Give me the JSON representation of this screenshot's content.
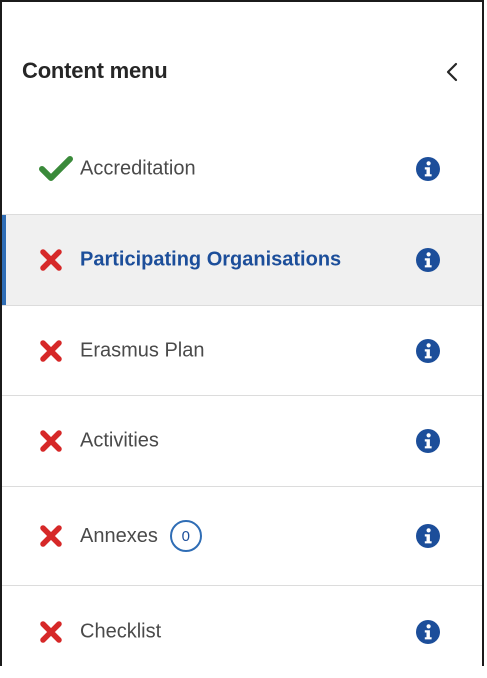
{
  "header": {
    "title": "Content menu",
    "collapse_icon": "chevron-left-icon"
  },
  "colors": {
    "accent": "#2f6db5",
    "active_text": "#1c4e9a",
    "success": "#3a8a3a",
    "error": "#d62828",
    "info": "#1c4e9a",
    "active_background": "#f0f0f0"
  },
  "menu": {
    "items": [
      {
        "label": "Accreditation",
        "status": "complete",
        "status_icon": "checkmark-icon",
        "info_icon": "info-icon",
        "active": false
      },
      {
        "label": "Participating Organisations",
        "status": "incomplete",
        "status_icon": "cross-icon",
        "info_icon": "info-icon",
        "active": true
      },
      {
        "label": "Erasmus Plan",
        "status": "incomplete",
        "status_icon": "cross-icon",
        "info_icon": "info-icon",
        "active": false
      },
      {
        "label": "Activities",
        "status": "incomplete",
        "status_icon": "cross-icon",
        "info_icon": "info-icon",
        "active": false
      },
      {
        "label": "Annexes",
        "status": "incomplete",
        "status_icon": "cross-icon",
        "info_icon": "info-icon",
        "active": false,
        "count": "0"
      },
      {
        "label": "Checklist",
        "status": "incomplete",
        "status_icon": "cross-icon",
        "info_icon": "info-icon",
        "active": false
      }
    ]
  }
}
